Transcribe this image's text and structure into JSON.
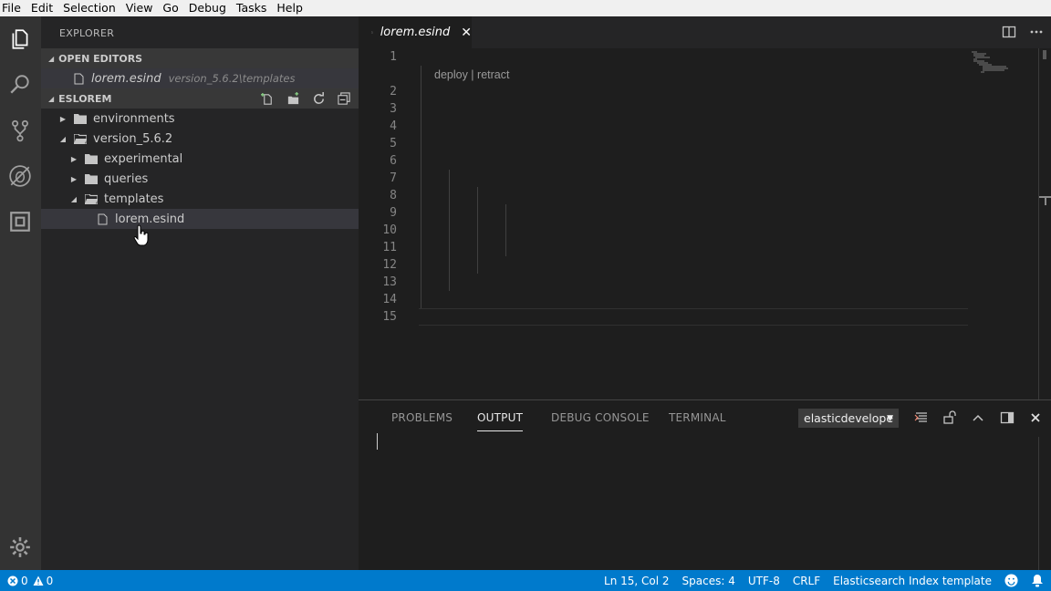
{
  "menu": [
    "File",
    "Edit",
    "Selection",
    "View",
    "Go",
    "Debug",
    "Tasks",
    "Help"
  ],
  "sidebar": {
    "title": "EXPLORER",
    "open_editors": {
      "header": "OPEN EDITORS",
      "items": [
        {
          "name": "lorem.esind",
          "description": "version_5.6.2\\templates"
        }
      ]
    },
    "workspace": {
      "header": "ESLOREM",
      "tree": [
        {
          "label": "environments",
          "depth": 0,
          "type": "folder",
          "expanded": false
        },
        {
          "label": "version_5.6.2",
          "depth": 0,
          "type": "folder",
          "expanded": true
        },
        {
          "label": "experimental",
          "depth": 1,
          "type": "folder",
          "expanded": false
        },
        {
          "label": "queries",
          "depth": 1,
          "type": "folder",
          "expanded": false
        },
        {
          "label": "templates",
          "depth": 1,
          "type": "folder",
          "expanded": true
        },
        {
          "label": "lorem.esind",
          "depth": 2,
          "type": "file",
          "selected": true
        }
      ]
    }
  },
  "editor": {
    "tab_label": "lorem.esind",
    "codelens": "deploy | retract",
    "line_numbers": [
      "1",
      "2",
      "3",
      "4",
      "5",
      "6",
      "7",
      "8",
      "9",
      "10",
      "11",
      "12",
      "13",
      "14",
      "15"
    ]
  },
  "panel": {
    "tabs": [
      "PROBLEMS",
      "OUTPUT",
      "DEBUG CONSOLE",
      "TERMINAL"
    ],
    "active_tab": "OUTPUT",
    "channel": "elasticdevelope"
  },
  "statusbar": {
    "errors": "0",
    "warnings": "0",
    "position": "Ln 15, Col 2",
    "spaces": "Spaces: 4",
    "encoding": "UTF-8",
    "eol": "CRLF",
    "language": "Elasticsearch Index template"
  },
  "colors": {
    "accent": "#007acc",
    "activity_bar": "#333333",
    "sidebar": "#252526",
    "editor": "#1e1e1e"
  }
}
